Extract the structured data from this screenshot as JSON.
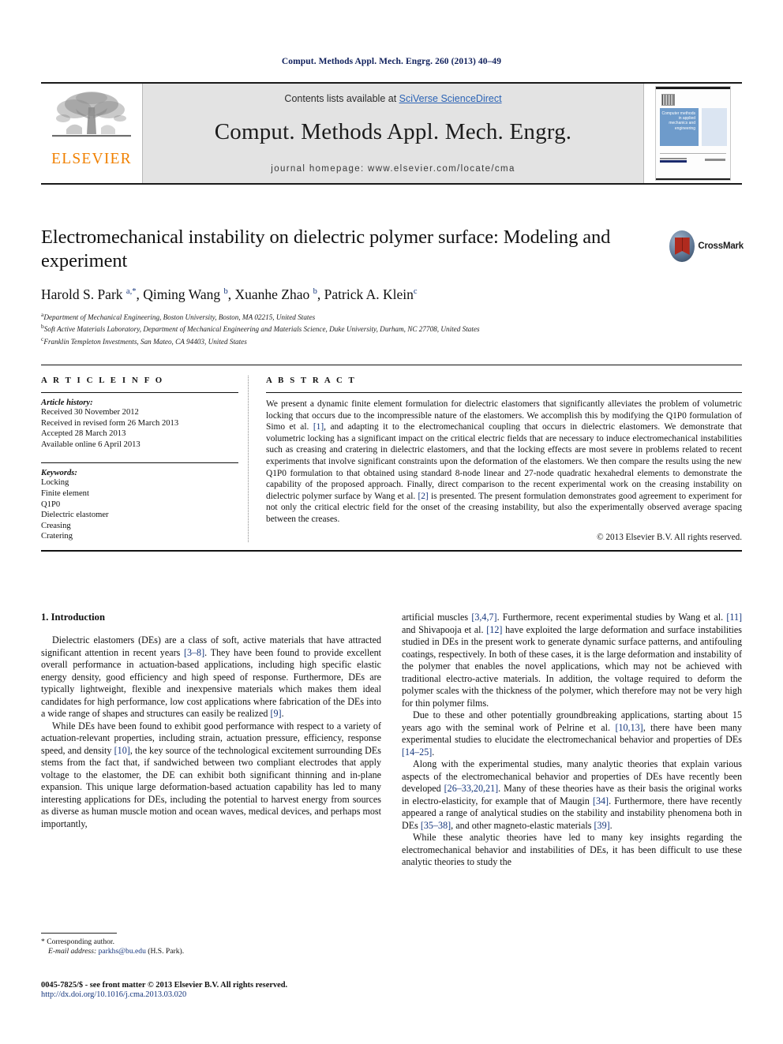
{
  "running_head": "Comput. Methods Appl. Mech. Engrg. 260 (2013) 40–49",
  "masthead": {
    "publisher_name": "ELSEVIER",
    "contents_prefix": "Contents lists available at ",
    "contents_link": "SciVerse ScienceDirect",
    "journal_title": "Comput. Methods Appl. Mech. Engrg.",
    "homepage": "journal homepage: www.elsevier.com/locate/cma",
    "cover_title": "Computer methods in applied mechanics and engineering"
  },
  "article": {
    "title": "Electromechanical instability on dielectric polymer surface: Modeling and experiment",
    "crossmark_label": "CrossMark",
    "authors_html": "Harold S. Park <sup>a,*</sup>, Qiming Wang <sup>b</sup>, Xuanhe Zhao <sup>b</sup>, Patrick A. Klein<sup>c</sup>",
    "affiliations": [
      {
        "marker": "a",
        "text": "Department of Mechanical Engineering, Boston University, Boston, MA 02215, United States"
      },
      {
        "marker": "b",
        "text": "Soft Active Materials Laboratory, Department of Mechanical Engineering and Materials Science, Duke University, Durham, NC 27708, United States"
      },
      {
        "marker": "c",
        "text": "Franklin Templeton Investments, San Mateo, CA 94403, United States"
      }
    ]
  },
  "info": {
    "heading": "A R T I C L E   I N F O",
    "history_title": "Article history:",
    "history": [
      "Received 30 November 2012",
      "Received in revised form 26 March 2013",
      "Accepted 28 March 2013",
      "Available online 6 April 2013"
    ],
    "keywords_title": "Keywords:",
    "keywords": [
      "Locking",
      "Finite element",
      "Q1P0",
      "Dielectric elastomer",
      "Creasing",
      "Cratering"
    ]
  },
  "abstract": {
    "heading": "A B S T R A C T",
    "body_html": "We present a dynamic finite element formulation for dielectric elastomers that significantly alleviates the problem of volumetric locking that occurs due to the incompressible nature of the elastomers. We accomplish this by modifying the Q1P0 formulation of Simo et al. <span class=\"ref\">[1]</span>, and adapting it to the electromechanical coupling that occurs in dielectric elastomers. We demonstrate that volumetric locking has a significant impact on the critical electric fields that are necessary to induce electromechanical instabilities such as creasing and cratering in dielectric elastomers, and that the locking effects are most severe in problems related to recent experiments that involve significant constraints upon the deformation of the elastomers. We then compare the results using the new Q1P0 formulation to that obtained using standard 8-node linear and 27-node quadratic hexahedral elements to demonstrate the capability of the proposed approach. Finally, direct comparison to the recent experimental work on the creasing instability on dielectric polymer surface by Wang et al. <span class=\"ref\">[2]</span> is presented. The present formulation demonstrates good agreement to experiment for not only the critical electric field for the onset of the creasing instability, but also the experimentally observed average spacing between the creases.",
    "copyright": "© 2013 Elsevier B.V. All rights reserved."
  },
  "body": {
    "section_title": "1. Introduction",
    "left_paragraphs_html": [
      "Dielectric elastomers (DEs) are a class of soft, active materials that have attracted significant attention in recent years <span class=\"ref\">[3–8]</span>. They have been found to provide excellent overall performance in actuation-based applications, including high specific elastic energy density, good efficiency and high speed of response. Furthermore, DEs are typically lightweight, flexible and inexpensive materials which makes them ideal candidates for high performance, low cost applications where fabrication of the DEs into a wide range of shapes and structures can easily be realized <span class=\"ref\">[9]</span>.",
      "While DEs have been found to exhibit good performance with respect to a variety of actuation-relevant properties, including strain, actuation pressure, efficiency, response speed, and density <span class=\"ref\">[10]</span>, the key source of the technological excitement surrounding DEs stems from the fact that, if sandwiched between two compliant electrodes that apply voltage to the elastomer, the DE can exhibit both significant thinning and in-plane expansion. This unique large deformation-based actuation capability has led to many interesting applications for DEs, including the potential to harvest energy from sources as diverse as human muscle motion and ocean waves, medical devices, and perhaps most importantly,"
    ],
    "right_paragraphs_html": [
      "artificial muscles <span class=\"ref\">[3,4,7]</span>. Furthermore, recent experimental studies by Wang et al. <span class=\"ref\">[11]</span> and Shivapooja et al. <span class=\"ref\">[12]</span> have exploited the large deformation and surface instabilities studied in DEs in the present work to generate dynamic surface patterns, and antifouling coatings, respectively. In both of these cases, it is the large deformation and instability of the polymer that enables the novel applications, which may not be achieved with traditional electro-active materials. In addition, the voltage required to deform the polymer scales with the thickness of the polymer, which therefore may not be very high for thin polymer films.",
      "Due to these and other potentially groundbreaking applications, starting about 15 years ago with the seminal work of Pelrine et al. <span class=\"ref\">[10,13]</span>, there have been many experimental studies to elucidate the electromechanical behavior and properties of DEs <span class=\"ref\">[14–25]</span>.",
      "Along with the experimental studies, many analytic theories that explain various aspects of the electromechanical behavior and properties of DEs have recently been developed <span class=\"ref\">[26–33,20,21]</span>. Many of these theories have as their basis the original works in electro-elasticity, for example that of Maugin <span class=\"ref\">[34]</span>. Furthermore, there have recently appeared a range of analytical studies on the stability and instability phenomena both in DEs <span class=\"ref\">[35–38]</span>, and other magneto-elastic materials <span class=\"ref\">[39]</span>.",
      "While these analytic theories have led to many key insights regarding the electromechanical behavior and instabilities of DEs, it has been difficult to use these analytic theories to study the"
    ]
  },
  "footnote": {
    "corresponding_html": "* Corresponding author.",
    "email_html": "<span class=\"em\">E-mail address:</span> <span class=\"mail\">parkhs@bu.edu</span> (H.S. Park)."
  },
  "bottom": {
    "issn": "0045-7825/$ - see front matter © 2013 Elsevier B.V. All rights reserved.",
    "doi": "http://dx.doi.org/10.1016/j.cma.2013.03.020"
  },
  "colors": {
    "link_blue": "#16377d",
    "sciencedirect_blue": "#2b63b5",
    "elsevier_orange": "#F08000",
    "band_gray": "#e3e3e3"
  }
}
